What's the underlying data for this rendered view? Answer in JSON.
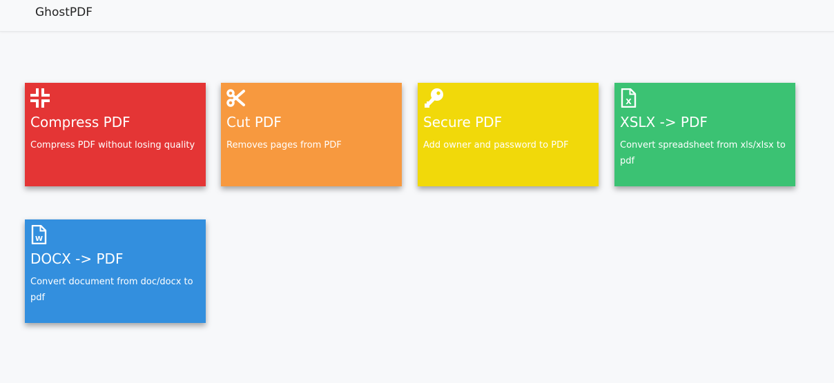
{
  "navbar": {
    "brand": "GhostPDF"
  },
  "cards": [
    {
      "title": "Compress PDF",
      "description": "Compress PDF without losing quality",
      "icon": "compress-icon",
      "color": "#e43535"
    },
    {
      "title": "Cut PDF",
      "description": "Removes pages from PDF",
      "icon": "scissors-icon",
      "color": "#f7993f"
    },
    {
      "title": "Secure PDF",
      "description": "Add owner and password to PDF",
      "icon": "key-icon",
      "color": "#f1d90a"
    },
    {
      "title": "XSLX -> PDF",
      "description": "Convert spreadsheet from xls/xlsx to pdf",
      "icon": "excel-file-icon",
      "color": "#3bc273"
    },
    {
      "title": "DOCX -> PDF",
      "description": "Convert document from doc/docx to pdf",
      "icon": "word-file-icon",
      "color": "#338fde"
    }
  ]
}
